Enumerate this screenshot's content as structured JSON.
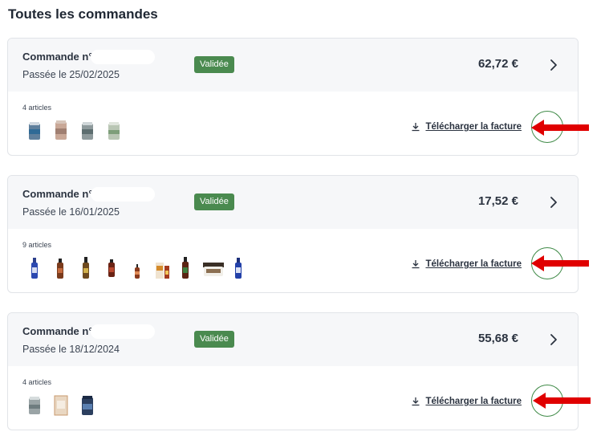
{
  "page": {
    "title": "Toutes les commandes"
  },
  "colors": {
    "badge": "#4a8a4f",
    "arrow": "#e00000",
    "circle": "#3f8a47"
  },
  "orders": [
    {
      "number": "Commande n°",
      "date": "Passée le 25/02/2025",
      "status": "Validée",
      "total": "62,72 €",
      "articles": "4 articles",
      "download": "Télécharger la facture",
      "products": [
        "blue-supplement-jar",
        "amber-supplement-jar",
        "grey-supplement-jar",
        "green-supplement-jar"
      ]
    },
    {
      "number": "Commande n°",
      "date": "Passée le 16/01/2025",
      "status": "Validée",
      "total": "17,52 €",
      "articles": "9 articles",
      "download": "Télécharger la facture",
      "products": [
        "blue-spray-bottle",
        "amber-dropper-bottle",
        "amber-spray-bottle",
        "amber-dropper-bottle",
        "small-dropper-bottle",
        "oil-box-set",
        "green-label-bottle",
        "cream-jar",
        "blue-spray-bottle"
      ]
    },
    {
      "number": "Commande n°",
      "date": "Passée le 18/12/2024",
      "status": "Validée",
      "total": "55,68 €",
      "articles": "4 articles",
      "download": "Télécharger la facture",
      "products": [
        "grey-supplement-jar",
        "beige-tea-box",
        "navy-supplement-jar"
      ]
    }
  ]
}
